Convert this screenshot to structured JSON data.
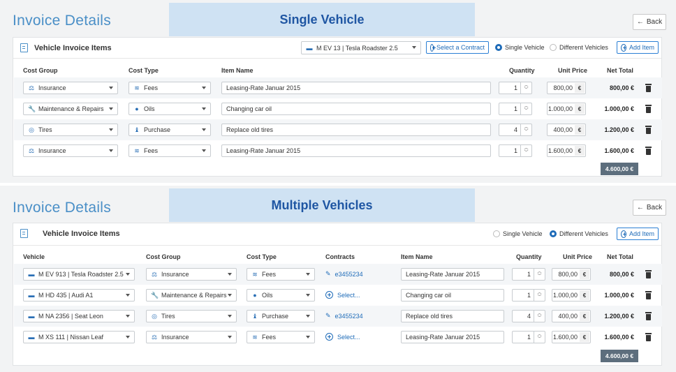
{
  "sec1": {
    "title": "Invoice Details",
    "banner": "Single Vehicle",
    "back": "Back",
    "card_title": "Vehicle Invoice Items",
    "vehicle_select": "M EV 13 | Tesla Roadster 2.5",
    "select_contract": "Select a Contract",
    "radio_single": "Single Vehicle",
    "radio_different": "Different Vehicles",
    "add_item": "Add Item",
    "headers": {
      "cost_group": "Cost Group",
      "cost_type": "Cost Type",
      "item_name": "Item Name",
      "quantity": "Quantity",
      "unit_price": "Unit Price",
      "net_total": "Net Total"
    },
    "rows": [
      {
        "cost_group": "Insurance",
        "cg_icon": "insurance-icon",
        "cost_type": "Fees",
        "ct_icon": "fees-icon",
        "item": "Leasing-Rate Januar 2015",
        "qty": "1",
        "price": "800,00",
        "net": "800,00 €"
      },
      {
        "cost_group": "Maintenance & Repairs",
        "cg_icon": "wrench-icon",
        "cost_type": "Oils",
        "ct_icon": "oil-drop-icon",
        "item": "Changing car oil",
        "qty": "1",
        "price": "1.000,00",
        "net": "1.000,00 €"
      },
      {
        "cost_group": "Tires",
        "cg_icon": "tire-icon",
        "cost_type": "Purchase",
        "ct_icon": "money-bag-icon",
        "item": "Replace old tires",
        "qty": "4",
        "price": "400,00",
        "net": "1.200,00 €"
      },
      {
        "cost_group": "Insurance",
        "cg_icon": "insurance-icon",
        "cost_type": "Fees",
        "ct_icon": "fees-icon",
        "item": "Leasing-Rate Januar 2015",
        "qty": "1",
        "price": "1.600,00",
        "net": "1.600,00 €"
      }
    ],
    "currency": "€",
    "total": "4.600,00 €"
  },
  "sec2": {
    "title": "Invoice Details",
    "banner": "Multiple Vehicles",
    "back": "Back",
    "card_title": "Vehicle Invoice Items",
    "radio_single": "Single Vehicle",
    "radio_different": "Different Vehicles",
    "add_item": "Add Item",
    "headers": {
      "vehicle": "Vehicle",
      "cost_group": "Cost Group",
      "cost_type": "Cost Type",
      "contracts": "Contracts",
      "item_name": "Item Name",
      "quantity": "Quantity",
      "unit_price": "Unit Price",
      "net_total": "Net Total"
    },
    "rows": [
      {
        "vehicle": "M EV 913 | Tesla Roadster 2.5",
        "cost_group": "Insurance",
        "cg_icon": "insurance-icon",
        "cost_type": "Fees",
        "ct_icon": "fees-icon",
        "contract": "e3455234",
        "contract_kind": "contract",
        "item": "Leasing-Rate Januar 2015",
        "qty": "1",
        "price": "800,00",
        "net": "800,00 €"
      },
      {
        "vehicle": "M HD 435 | Audi A1",
        "cost_group": "Maintenance & Repairs",
        "cg_icon": "wrench-icon",
        "cost_type": "Oils",
        "ct_icon": "oil-drop-icon",
        "contract": "Select...",
        "contract_kind": "select",
        "item": "Changing car oil",
        "qty": "1",
        "price": "1.000,00",
        "net": "1.000,00 €"
      },
      {
        "vehicle": "M NA 2356 | Seat Leon",
        "cost_group": "Tires",
        "cg_icon": "tire-icon",
        "cost_type": "Purchase",
        "ct_icon": "money-bag-icon",
        "contract": "e3455234",
        "contract_kind": "contract",
        "item": "Replace old tires",
        "qty": "4",
        "price": "400,00",
        "net": "1.200,00 €"
      },
      {
        "vehicle": "M XS 111 | Nissan Leaf",
        "cost_group": "Insurance",
        "cg_icon": "insurance-icon",
        "cost_type": "Fees",
        "ct_icon": "fees-icon",
        "contract": "Select...",
        "contract_kind": "select",
        "item": "Leasing-Rate Januar 2015",
        "qty": "1",
        "price": "1.600,00",
        "net": "1.600,00 €"
      }
    ],
    "currency": "€",
    "total": "4.600,00 €"
  },
  "colors": {
    "accent": "#1e6bb8",
    "title": "#4a8fc7",
    "banner_bg": "#cfe2f3",
    "banner_text": "#1f56a3",
    "total_bg": "#5d6e7d"
  }
}
